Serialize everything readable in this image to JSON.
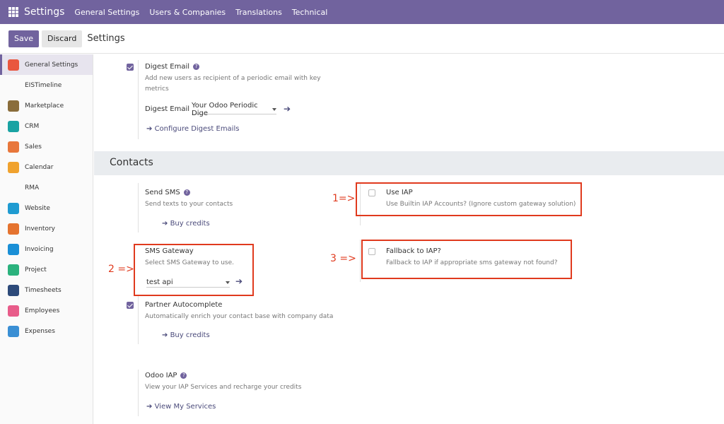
{
  "topbar": {
    "brand": "Settings",
    "nav": [
      "General Settings",
      "Users & Companies",
      "Translations",
      "Technical"
    ]
  },
  "controls": {
    "save": "Save",
    "discard": "Discard",
    "title": "Settings"
  },
  "sidebar": {
    "items": [
      {
        "label": "General Settings",
        "icon": "general-settings-icon",
        "color": "#e9573f"
      },
      {
        "label": "EISTimeline",
        "icon": "none",
        "color": ""
      },
      {
        "label": "Marketplace",
        "icon": "marketplace-icon",
        "color": "#8a6d3b"
      },
      {
        "label": "CRM",
        "icon": "crm-icon",
        "color": "#1aa3a3"
      },
      {
        "label": "Sales",
        "icon": "sales-icon",
        "color": "#e8773b"
      },
      {
        "label": "Calendar",
        "icon": "calendar-icon",
        "color": "#f0a22e"
      },
      {
        "label": "RMA",
        "icon": "none",
        "color": ""
      },
      {
        "label": "Website",
        "icon": "website-icon",
        "color": "#1f9bd1"
      },
      {
        "label": "Inventory",
        "icon": "inventory-icon",
        "color": "#e5732f"
      },
      {
        "label": "Invoicing",
        "icon": "invoicing-icon",
        "color": "#1a8fd6"
      },
      {
        "label": "Project",
        "icon": "project-icon",
        "color": "#2bb27d"
      },
      {
        "label": "Timesheets",
        "icon": "timesheets-icon",
        "color": "#2d4a7a"
      },
      {
        "label": "Employees",
        "icon": "employees-icon",
        "color": "#e85c8a"
      },
      {
        "label": "Expenses",
        "icon": "expenses-icon",
        "color": "#3a8fd4"
      }
    ]
  },
  "digest": {
    "title": "Digest Email",
    "desc_line1": "Add new users as recipient of a periodic email with key",
    "desc_line2": "metrics",
    "field_label": "Digest Email",
    "field_value": "Your Odoo Periodic Dige",
    "configure_link": "Configure Digest Emails"
  },
  "section": {
    "contacts": "Contacts"
  },
  "send_sms": {
    "title": "Send SMS",
    "desc": "Send texts to your contacts",
    "buy": "Buy credits"
  },
  "use_iap": {
    "title": "Use IAP",
    "desc": "Use Builtin IAP Accounts? (Ignore custom gateway solution)"
  },
  "sms_gateway": {
    "title": "SMS Gateway",
    "desc": "Select SMS Gateway to use.",
    "value": "test api"
  },
  "fallback": {
    "title": "Fallback to IAP?",
    "desc": "Fallback to IAP if appropriate sms gateway not found?"
  },
  "partner": {
    "title": "Partner Autocomplete",
    "desc": "Automatically enrich your contact base with company data",
    "buy": "Buy credits"
  },
  "odoo_iap": {
    "title": "Odoo IAP",
    "desc": "View your IAP Services and recharge your credits",
    "link": "View My Services"
  },
  "annotations": {
    "one": "1=>",
    "two": "2 =>",
    "three": "3 =>"
  },
  "colors": {
    "brand": "#71639e",
    "annotation": "#e03a1e"
  }
}
